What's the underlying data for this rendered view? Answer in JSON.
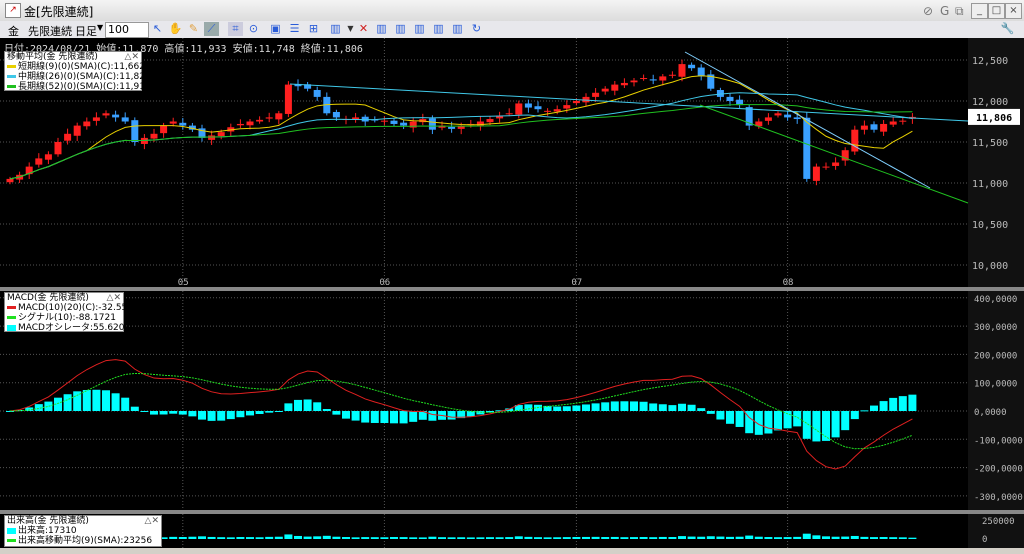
{
  "window": {
    "title": "金[先限連続]"
  },
  "toolbar": {
    "commodity": "金",
    "contract": "先限連続",
    "period": "日足",
    "count": "100"
  },
  "info": "日付:2024/08/21 始値:11,870 高値:11,933 安値:11,748 終値:11,806",
  "ma_legend": {
    "title": "移動平均(金 先限連続)",
    "items": [
      {
        "label": "短期線(9)(0)(SMA)(C):11,662",
        "color": "#e8d000"
      },
      {
        "label": "中期線(26)(0)(SMA)(C):11,825",
        "color": "#40c8e8"
      },
      {
        "label": "長期線(52)(0)(SMA)(C):11,914",
        "color": "#20c020"
      }
    ]
  },
  "macd_legend": {
    "title": "MACD(金 先限連続)",
    "items": [
      {
        "label": "MACD(10)(20)(C):-32.5518",
        "color": "#e02020"
      },
      {
        "label": "シグナル(10):-88.1721",
        "color": "#20e020"
      },
      {
        "label": "MACDオシレータ:55.6203",
        "color": "#00ffff"
      }
    ]
  },
  "vol_legend": {
    "title": "出来高(金 先限連続)",
    "items": [
      {
        "label": "出来高:17310",
        "color": "#00ffff"
      },
      {
        "label": "出来高移動平均(9)(SMA):23256",
        "color": "#20e020"
      }
    ]
  },
  "current_price": "11,806",
  "chart_data": {
    "type": "candlestick",
    "x_labels": [
      "05",
      "06",
      "07",
      "08"
    ],
    "x_label_index": [
      18,
      39,
      59,
      81
    ],
    "price_ticks": [
      "12,500",
      "12,000",
      "11,500",
      "11,000",
      "10,500",
      "10,000"
    ],
    "price_tick_values": [
      12500,
      12000,
      11500,
      11000,
      10500,
      10000
    ],
    "macd_ticks": [
      "400,0000",
      "300,0000",
      "200,0000",
      "100,0000",
      "0,0000",
      "-100,0000",
      "-200,0000",
      "-300,0000"
    ],
    "macd_tick_values": [
      400000,
      300000,
      200000,
      100000,
      0,
      -100000,
      -200000,
      -300000
    ],
    "vol_ticks": [
      "250000",
      "0"
    ],
    "closes": [
      11050,
      11100,
      11200,
      11300,
      11350,
      11500,
      11600,
      11700,
      11750,
      11800,
      11850,
      11800,
      11750,
      11500,
      11550,
      11600,
      11700,
      11750,
      11700,
      11650,
      11550,
      11580,
      11620,
      11680,
      11720,
      11750,
      11770,
      11800,
      11850,
      12200,
      12180,
      12150,
      12050,
      11850,
      11800,
      11780,
      11800,
      11750,
      11770,
      11760,
      11720,
      11700,
      11750,
      11780,
      11650,
      11700,
      11660,
      11700,
      11720,
      11750,
      11780,
      11820,
      11850,
      11970,
      11920,
      11900,
      11880,
      11900,
      11950,
      12000,
      12050,
      12100,
      12150,
      12200,
      12220,
      12250,
      12280,
      12250,
      12300,
      12320,
      12450,
      12400,
      12300,
      12150,
      12050,
      12000,
      11950,
      11700,
      11750,
      11800,
      11850,
      11800,
      11780,
      11050,
      11200,
      11200,
      11250,
      11400,
      11650,
      11700,
      11650,
      11720,
      11750,
      11760,
      11806
    ],
    "volumes": [
      30000,
      25000,
      40000,
      22000,
      35000,
      28000,
      30000,
      26000,
      24000,
      31000,
      27000,
      29000,
      33000,
      45000,
      30000,
      25000,
      22000,
      28000,
      26000,
      30000,
      35000,
      27000,
      24000,
      22000,
      26000,
      25000,
      23000,
      28000,
      30000,
      60000,
      40000,
      32000,
      35000,
      42000,
      30000,
      26000,
      22000,
      25000,
      24000,
      23000,
      26000,
      25000,
      22000,
      21000,
      30000,
      24000,
      22000,
      23000,
      21000,
      22000,
      24000,
      23000,
      25000,
      35000,
      28000,
      24000,
      22000,
      23000,
      25000,
      26000,
      27000,
      28000,
      26000,
      27000,
      24000,
      25000,
      26000,
      24000,
      27000,
      26000,
      38000,
      32000,
      30000,
      36000,
      32000,
      28000,
      30000,
      45000,
      30000,
      26000,
      24000,
      25000,
      28000,
      70000,
      48000,
      35000,
      30000,
      32000,
      40000,
      28000,
      25000,
      26000,
      24000,
      22000,
      17310
    ]
  }
}
